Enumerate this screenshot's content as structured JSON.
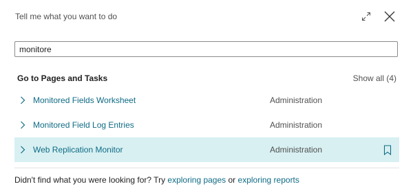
{
  "header": {
    "title": "Tell me what you want to do",
    "expand_icon": "expand-icon",
    "close_icon": "close-icon"
  },
  "search": {
    "value": "monitore",
    "placeholder": ""
  },
  "section": {
    "title": "Go to Pages and Tasks",
    "show_all": "Show all (4)"
  },
  "results": [
    {
      "name": "Monitored Fields Worksheet",
      "category": "Administration",
      "selected": false
    },
    {
      "name": "Monitored Field Log Entries",
      "category": "Administration",
      "selected": false
    },
    {
      "name": "Web Replication Monitor",
      "category": "Administration",
      "selected": true
    }
  ],
  "footer": {
    "prefix": "Didn't find what you were looking for? Try",
    "link1": "exploring pages",
    "middle": "or",
    "link2": "exploring reports"
  },
  "colors": {
    "accent": "#0f6b85",
    "selected_row": "#d8f0f2"
  }
}
